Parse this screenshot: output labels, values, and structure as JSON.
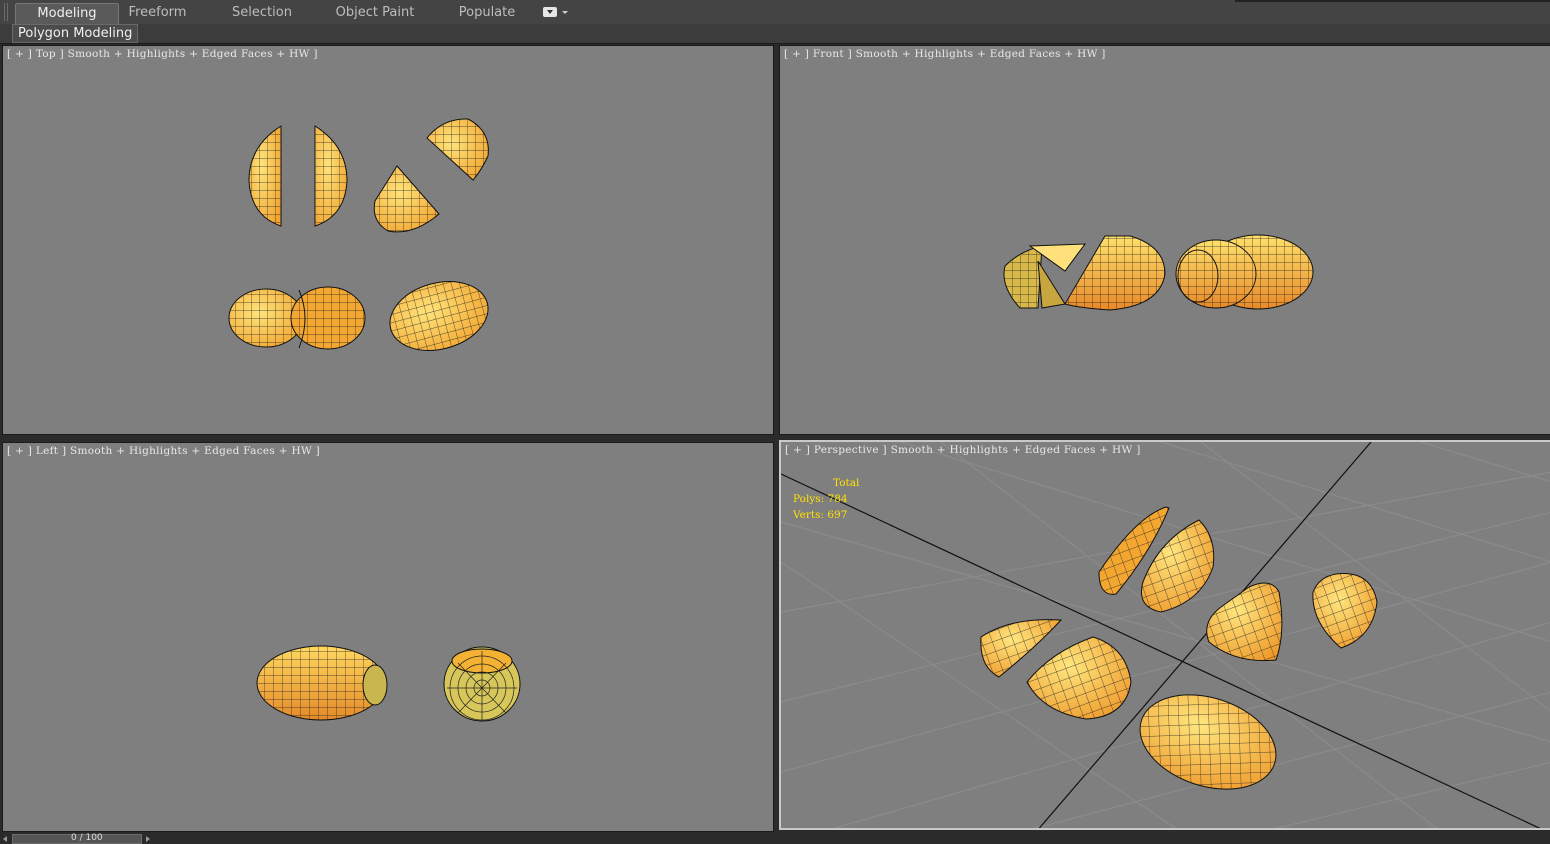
{
  "ribbon": {
    "tabs": [
      {
        "label": "Modeling",
        "active": true
      },
      {
        "label": "Freeform",
        "active": false
      },
      {
        "label": "Selection",
        "active": false
      },
      {
        "label": "Object Paint",
        "active": false
      },
      {
        "label": "Populate",
        "active": false
      }
    ],
    "panel_label": "Polygon Modeling",
    "dropdown_icon": "ribbon-options-icon"
  },
  "viewports": {
    "top": {
      "label_parts": [
        "[ + ] ",
        "Top ",
        "] ",
        "Smooth + Highlights + Edged Faces + HW ]"
      ]
    },
    "front": {
      "label_parts": [
        "[ + ] ",
        "Front ",
        "] ",
        "Smooth + Highlights + Edged Faces + HW ]"
      ]
    },
    "left": {
      "label_parts": [
        "[ + ] ",
        "Left ",
        "] ",
        "Smooth + Highlights + Edged Faces + HW ]"
      ]
    },
    "perspective": {
      "label_parts": [
        "[ + ] ",
        "Perspective ",
        "] ",
        "Smooth + Highlights + Edged Faces + HW ]"
      ],
      "stats": {
        "title": "Total",
        "polys": "Polys: 784",
        "verts": "Verts: 697"
      }
    }
  },
  "timeline": {
    "frame_label": "0 / 100"
  },
  "colors": {
    "viewport_bg": "#7f7f7f",
    "mesh_fill": "#f5b63d",
    "mesh_highlight": "#ffe37a",
    "mesh_edge": "#1a1a1a",
    "stats_text": "#ffe000"
  }
}
